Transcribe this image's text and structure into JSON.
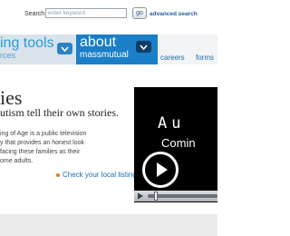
{
  "search": {
    "label": "Search",
    "placeholder": "enter keyword",
    "go_label": "go",
    "advanced_label": "advanced search"
  },
  "nav": {
    "tab1_main": "ing tools",
    "tab1_sub": "rces",
    "tab2_main": "about",
    "tab2_sub": "massmutual",
    "links": [
      "careers",
      "forms"
    ]
  },
  "hero": {
    "title": "ies",
    "subtitle": "utism tell their own stories.",
    "body_lines": [
      "ing of Age is a public television",
      "y that provides an honest look",
      "facing these families as their",
      "ome adults."
    ],
    "listing_link": "Check your local listings"
  },
  "player": {
    "title": "Au",
    "subtitle": "Comin"
  },
  "colors": {
    "accent_blue": "#1a7fc7",
    "link_blue": "#1a6fb0",
    "bullet_orange": "#e07a22"
  }
}
